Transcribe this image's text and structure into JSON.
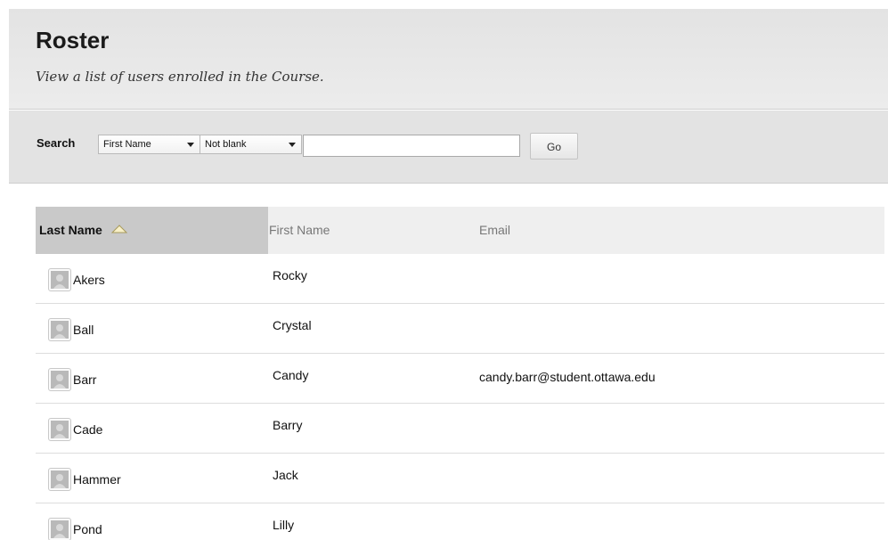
{
  "header": {
    "title": "Roster",
    "subtitle": "View a list of users enrolled in the Course."
  },
  "search": {
    "label": "Search",
    "field_selected": "First Name",
    "operator_selected": "Not blank",
    "query_value": "",
    "go_label": "Go"
  },
  "table": {
    "columns": {
      "last_name": "Last Name",
      "first_name": "First Name",
      "email": "Email"
    },
    "sort": {
      "column": "last_name",
      "direction": "ascending"
    },
    "rows": [
      {
        "last": "Akers",
        "first": "Rocky",
        "email": ""
      },
      {
        "last": "Ball",
        "first": "Crystal",
        "email": ""
      },
      {
        "last": "Barr",
        "first": "Candy",
        "email": "candy.barr@student.ottawa.edu"
      },
      {
        "last": "Cade",
        "first": "Barry",
        "email": ""
      },
      {
        "last": "Hammer",
        "first": "Jack",
        "email": ""
      },
      {
        "last": "Pond",
        "first": "Lilly",
        "email": ""
      }
    ]
  },
  "icons": {
    "avatar": "user-avatar-icon",
    "sort": "sort-ascending-triangle-icon",
    "dropdown": "chevron-down-icon"
  }
}
